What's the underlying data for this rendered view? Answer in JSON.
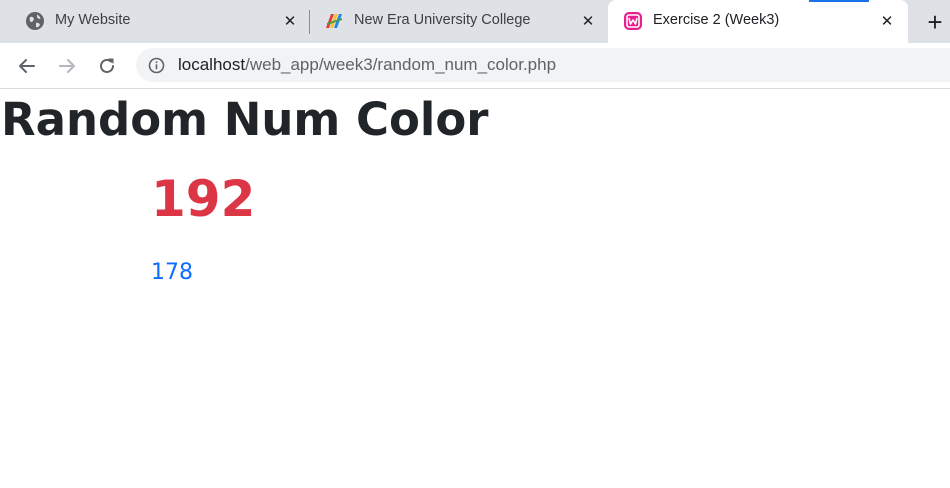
{
  "browser": {
    "tabs": [
      {
        "title": "My Website",
        "icon": "globe-icon",
        "active": false
      },
      {
        "title": "New Era University College",
        "icon": "neuc-logo-icon",
        "active": false
      },
      {
        "title": "Exercise 2 (Week3)",
        "icon": "wampserver-icon",
        "active": true
      }
    ],
    "new_tab_symbol": "+",
    "address": {
      "host": "localhost",
      "path": "/web_app/week3/random_num_color.php"
    },
    "accent_color": "#1a73e8"
  },
  "page": {
    "heading": "Random Num Color",
    "number_primary": "192",
    "number_primary_color": "#dc3545",
    "number_secondary": "178",
    "number_secondary_color": "#0d6efd"
  }
}
